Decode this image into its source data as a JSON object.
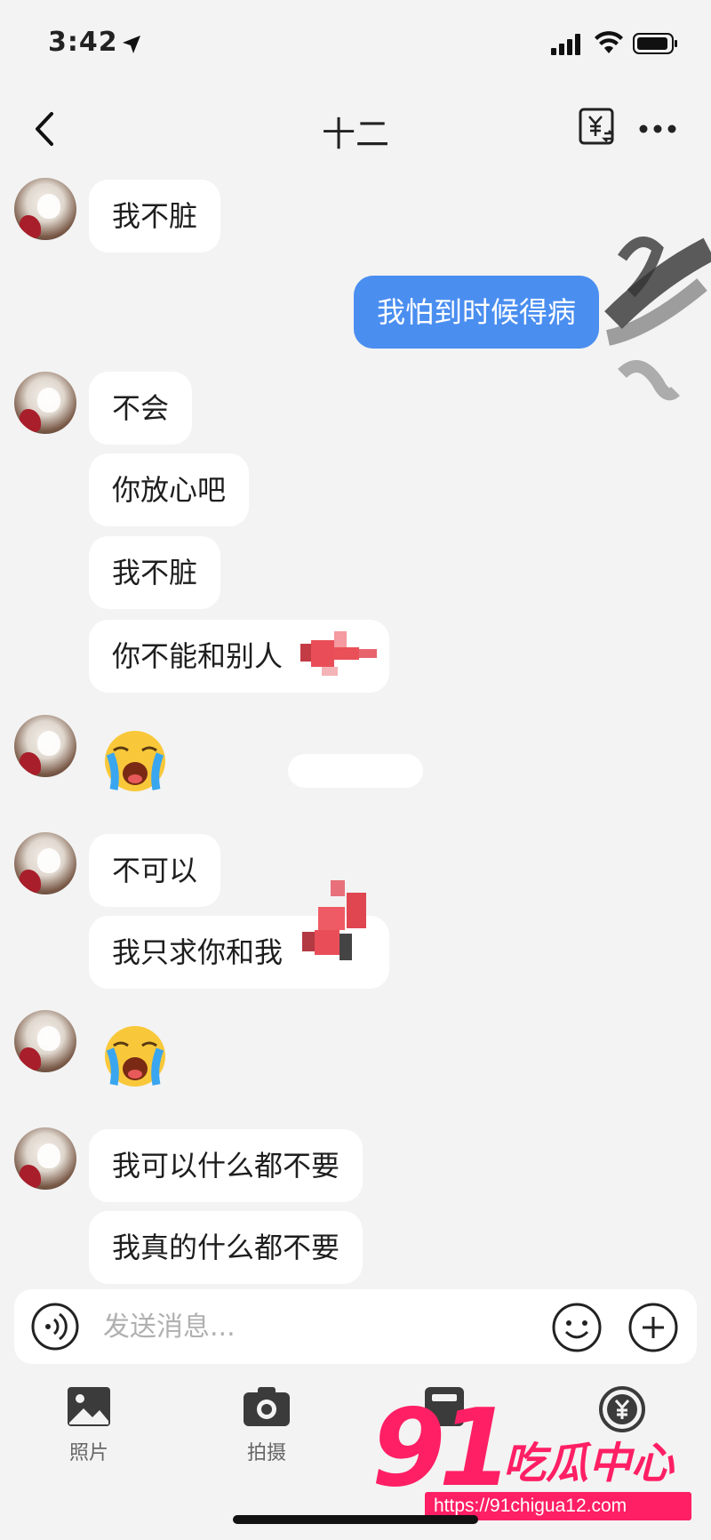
{
  "status_bar": {
    "time": "3:42",
    "icons": [
      "location-arrow-icon",
      "signal-icon",
      "wifi-icon",
      "battery-icon"
    ]
  },
  "header": {
    "title": "十二",
    "icons": [
      "back-icon",
      "transfer-icon",
      "more-icon"
    ]
  },
  "colors": {
    "background": "#f3f3f3",
    "incoming_bubble": "#ffffff",
    "outgoing_bubble": "#4a8ef0",
    "watermark": "#ff1f64"
  },
  "messages": [
    {
      "side": "left",
      "text": "我不脏"
    },
    {
      "side": "right",
      "text": "我怕到时候得病"
    },
    {
      "side": "left",
      "text": "不会"
    },
    {
      "side": "left",
      "text": "你放心吧"
    },
    {
      "side": "left",
      "text": "我不脏"
    },
    {
      "side": "left",
      "text": "你不能和别人"
    },
    {
      "side": "left",
      "type": "emoji",
      "emoji": "loudly-crying-face"
    },
    {
      "side": "left",
      "text": "不可以"
    },
    {
      "side": "left",
      "text": "我只求你和我"
    },
    {
      "side": "left",
      "type": "emoji",
      "emoji": "loudly-crying-face"
    },
    {
      "side": "left",
      "text": "我可以什么都不要"
    },
    {
      "side": "left",
      "text": "我真的什么都不要"
    }
  ],
  "input": {
    "placeholder": "发送消息..."
  },
  "toolbar": {
    "items": [
      {
        "label": "照片",
        "icon": "photo-icon"
      },
      {
        "label": "拍摄",
        "icon": "camera-icon"
      },
      {
        "label": "",
        "icon": "album-icon"
      },
      {
        "label": "",
        "icon": "yuan-transfer-icon"
      }
    ]
  },
  "watermark": {
    "number": "91",
    "text": "吃瓜中心",
    "url": "https://91chigua12.com"
  }
}
